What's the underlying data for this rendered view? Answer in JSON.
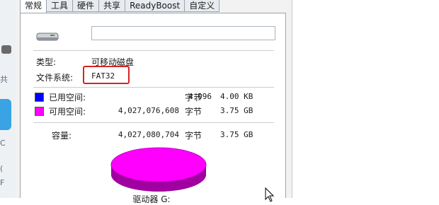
{
  "tabs": [
    {
      "label": "常规",
      "active": true
    },
    {
      "label": "工具",
      "active": false
    },
    {
      "label": "硬件",
      "active": false
    },
    {
      "label": "共享",
      "active": false
    },
    {
      "label": "ReadyBoost",
      "active": false
    },
    {
      "label": "自定义",
      "active": false
    }
  ],
  "drive_name_value": "",
  "properties": {
    "type_label": "类型:",
    "type_value": "可移动磁盘",
    "fs_label": "文件系统:",
    "fs_value": "FAT32"
  },
  "space": {
    "used": {
      "label": "已用空间:",
      "bytes": "4,096",
      "unit": "字节",
      "human": "4.00 KB",
      "color": "#0000ff"
    },
    "free": {
      "label": "可用空间:",
      "bytes": "4,027,076,608",
      "unit": "字节",
      "human": "3.75 GB",
      "color": "#ff00ff"
    },
    "capacity": {
      "label": "容量:",
      "bytes": "4,027,080,704",
      "unit": "字节",
      "human": "3.75 GB"
    }
  },
  "pie_caption": "驱动器 G:",
  "icons": {
    "drive": "usb-drive-icon",
    "cursor": "mouse-cursor-icon"
  },
  "background_fragments": [
    "共",
    "C",
    "(",
    "F"
  ]
}
